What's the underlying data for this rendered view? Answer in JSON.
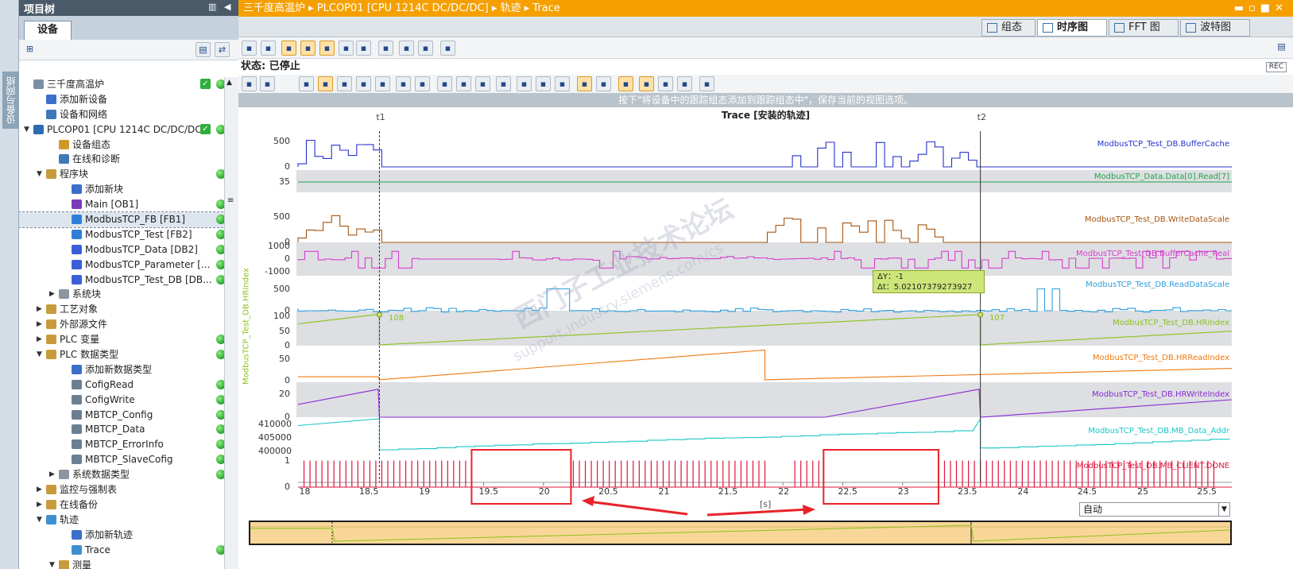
{
  "side_strip": {
    "label": "设备与网络"
  },
  "tree": {
    "title": "项目树",
    "tab": "设备",
    "items": [
      {
        "label": "三千度高温炉",
        "indent": 0,
        "expand": "",
        "icon": "doc",
        "check": true,
        "status": true
      },
      {
        "label": "添加新设备",
        "indent": 1,
        "expand": "",
        "icon": "add",
        "check": false,
        "status": false
      },
      {
        "label": "设备和网络",
        "indent": 1,
        "expand": "",
        "icon": "net",
        "check": false,
        "status": false
      },
      {
        "label": "PLCOP01 [CPU 1214C DC/DC/DC]",
        "indent": 0,
        "expand": "▼",
        "icon": "plc",
        "check": true,
        "status": true
      },
      {
        "label": "设备组态",
        "indent": 2,
        "expand": "",
        "icon": "cfg",
        "check": false,
        "status": false
      },
      {
        "label": "在线和诊断",
        "indent": 2,
        "expand": "",
        "icon": "diag",
        "check": false,
        "status": false
      },
      {
        "label": "程序块",
        "indent": 1,
        "expand": "▼",
        "icon": "folder",
        "check": false,
        "status": true
      },
      {
        "label": "添加新块",
        "indent": 3,
        "expand": "",
        "icon": "add",
        "check": false,
        "status": false
      },
      {
        "label": "Main [OB1]",
        "indent": 3,
        "expand": "",
        "icon": "ob",
        "check": false,
        "status": true
      },
      {
        "label": "ModbusTCP_FB [FB1]",
        "indent": 3,
        "expand": "",
        "icon": "fb",
        "check": false,
        "status": true,
        "selected": true
      },
      {
        "label": "ModbusTCP_Test [FB2]",
        "indent": 3,
        "expand": "",
        "icon": "fb",
        "check": false,
        "status": true
      },
      {
        "label": "ModbusTCP_Data [DB2]",
        "indent": 3,
        "expand": "",
        "icon": "db",
        "check": false,
        "status": true
      },
      {
        "label": "ModbusTCP_Parameter [...",
        "indent": 3,
        "expand": "",
        "icon": "db",
        "check": false,
        "status": true
      },
      {
        "label": "ModbusTCP_Test_DB [DB...",
        "indent": 3,
        "expand": "",
        "icon": "db",
        "check": false,
        "status": true
      },
      {
        "label": "系统块",
        "indent": 2,
        "expand": "▶",
        "icon": "sys",
        "check": false,
        "status": false
      },
      {
        "label": "工艺对象",
        "indent": 1,
        "expand": "▶",
        "icon": "folder",
        "check": false,
        "status": false
      },
      {
        "label": "外部源文件",
        "indent": 1,
        "expand": "▶",
        "icon": "folder",
        "check": false,
        "status": false
      },
      {
        "label": "PLC 变量",
        "indent": 1,
        "expand": "▶",
        "icon": "folder",
        "check": false,
        "status": true
      },
      {
        "label": "PLC 数据类型",
        "indent": 1,
        "expand": "▼",
        "icon": "folder",
        "check": false,
        "status": true
      },
      {
        "label": "添加新数据类型",
        "indent": 3,
        "expand": "",
        "icon": "add",
        "check": false,
        "status": false
      },
      {
        "label": "CofigRead",
        "indent": 3,
        "expand": "",
        "icon": "udt",
        "check": false,
        "status": true
      },
      {
        "label": "CofigWrite",
        "indent": 3,
        "expand": "",
        "icon": "udt",
        "check": false,
        "status": true
      },
      {
        "label": "MBTCP_Config",
        "indent": 3,
        "expand": "",
        "icon": "udt",
        "check": false,
        "status": true
      },
      {
        "label": "MBTCP_Data",
        "indent": 3,
        "expand": "",
        "icon": "udt",
        "check": false,
        "status": true
      },
      {
        "label": "MBTCP_ErrorInfo",
        "indent": 3,
        "expand": "",
        "icon": "udt",
        "check": false,
        "status": true
      },
      {
        "label": "MBTCP_SlaveCofig",
        "indent": 3,
        "expand": "",
        "icon": "udt",
        "check": false,
        "status": true
      },
      {
        "label": "系统数据类型",
        "indent": 2,
        "expand": "▶",
        "icon": "sys",
        "check": false,
        "status": true
      },
      {
        "label": "监控与强制表",
        "indent": 1,
        "expand": "▶",
        "icon": "folder",
        "check": false,
        "status": false
      },
      {
        "label": "在线备份",
        "indent": 1,
        "expand": "▶",
        "icon": "folder",
        "check": false,
        "status": false
      },
      {
        "label": "轨迹",
        "indent": 1,
        "expand": "▼",
        "icon": "trace",
        "check": false,
        "status": false
      },
      {
        "label": "添加新轨迹",
        "indent": 3,
        "expand": "",
        "icon": "add",
        "check": false,
        "status": false
      },
      {
        "label": "Trace",
        "indent": 3,
        "expand": "",
        "icon": "trace",
        "check": false,
        "status": true
      },
      {
        "label": "测量",
        "indent": 2,
        "expand": "▼",
        "icon": "folder",
        "check": false,
        "status": false
      }
    ]
  },
  "breadcrumb": {
    "text": "三千度高温炉  ▸  PLCOP01 [CPU 1214C DC/DC/DC]  ▸  轨迹  ▸  Trace"
  },
  "view_tabs": [
    {
      "label": "组态",
      "active": false
    },
    {
      "label": "时序图",
      "active": true
    },
    {
      "label": "FFT 图",
      "active": false
    },
    {
      "label": "波特图",
      "active": false
    }
  ],
  "status": {
    "text": "状态: 已停止",
    "rec": "REC"
  },
  "hint": "按下\"将设备中的跟踪组态添加到跟踪组态中\"，保存当前的视图选项。",
  "chart_title": "Trace [安装的轨迹]",
  "cursors": {
    "t1_label": "t1",
    "t2_label": "t2",
    "t1_x": 18.63,
    "t2_x": 23.65,
    "hrindex_t1": "108",
    "hrindex_t2": "107",
    "delta_y": "ΔY：-1",
    "delta_t": "Δt：5.02107379273927"
  },
  "left_axis_label": "ModbusTCP_Test_DB.HRIndex",
  "x_axis_unit": "[s]",
  "zoom_mode": "自动",
  "watermark": "西门子工业技术论坛",
  "watermark2": "support.industry.siemens.com/cs",
  "colors": {
    "orange": "#f5a000",
    "red_box": "#e8232b"
  },
  "chart_data": {
    "type": "line",
    "xlim": [
      17.95,
      25.75
    ],
    "x_ticks": [
      "18",
      "18.5",
      "19",
      "19.5",
      "20",
      "20.5",
      "21",
      "21.5",
      "22",
      "22.5",
      "23",
      "23.5",
      "24",
      "24.5",
      "25",
      "25.5"
    ],
    "highlight_ranges": [
      [
        19.4,
        20.23
      ],
      [
        22.34,
        23.3
      ]
    ],
    "signals": [
      {
        "name": "ModbusTCP_Test_DB.BufferCache",
        "color": "#2431c9",
        "yticks": [
          "500",
          "0"
        ],
        "ylim": [
          0,
          700
        ],
        "shape": "pulses"
      },
      {
        "name": "ModbusTCP_Data.Data[0].Read[7]",
        "color": "#24a34a",
        "yticks": [
          "35"
        ],
        "ylim": [
          0,
          70
        ],
        "shape": "flat",
        "value": 35
      },
      {
        "name": "ModbusTCP_Test_DB.WriteDataScale",
        "color": "#a55410",
        "yticks": [
          "500",
          "0"
        ],
        "ylim": [
          0,
          700
        ],
        "shape": "pulses"
      },
      {
        "name": "ModbusTCP_Test_DB.BufferCache_Real",
        "color": "#d83ccf",
        "yticks": [
          "1000",
          "0",
          "-1000"
        ],
        "ylim": [
          -1300,
          1300
        ],
        "shape": "square"
      },
      {
        "name": "ModbusTCP_Test_DB.ReadDataScale",
        "color": "#2d9fdc",
        "yticks": [
          "500",
          "0"
        ],
        "ylim": [
          0,
          800
        ],
        "shape": "small"
      },
      {
        "name": "ModbusTCP_Test_DB.HRIndex",
        "color": "#8cc21b",
        "yticks": [
          "100",
          "50",
          "0"
        ],
        "ylim": [
          0,
          120
        ],
        "shape": "ramp"
      },
      {
        "name": "ModbusTCP_Test_DB.HRReadIndex",
        "color": "#f07a10",
        "yticks": [
          "50",
          "0"
        ],
        "ylim": [
          0,
          80
        ],
        "shape": "ramp2"
      },
      {
        "name": "ModbusTCP_Test_DB.HRWriteIndex",
        "color": "#8a2ad5",
        "yticks": [
          "20",
          "0"
        ],
        "ylim": [
          0,
          30
        ],
        "shape": "ramp3"
      },
      {
        "name": "ModbusTCP_Test_DB.MB_Data_Addr",
        "color": "#1cc6c6",
        "yticks": [
          "410000",
          "405000",
          "400000"
        ],
        "ylim": [
          399000,
          412000
        ],
        "shape": "stair"
      },
      {
        "name": "ModbusTCP_Test_DB.MB_CLIENT.DONE",
        "color": "#e0143c",
        "yticks": [
          "1",
          "0"
        ],
        "ylim": [
          0,
          1.2
        ],
        "shape": "done"
      }
    ]
  }
}
